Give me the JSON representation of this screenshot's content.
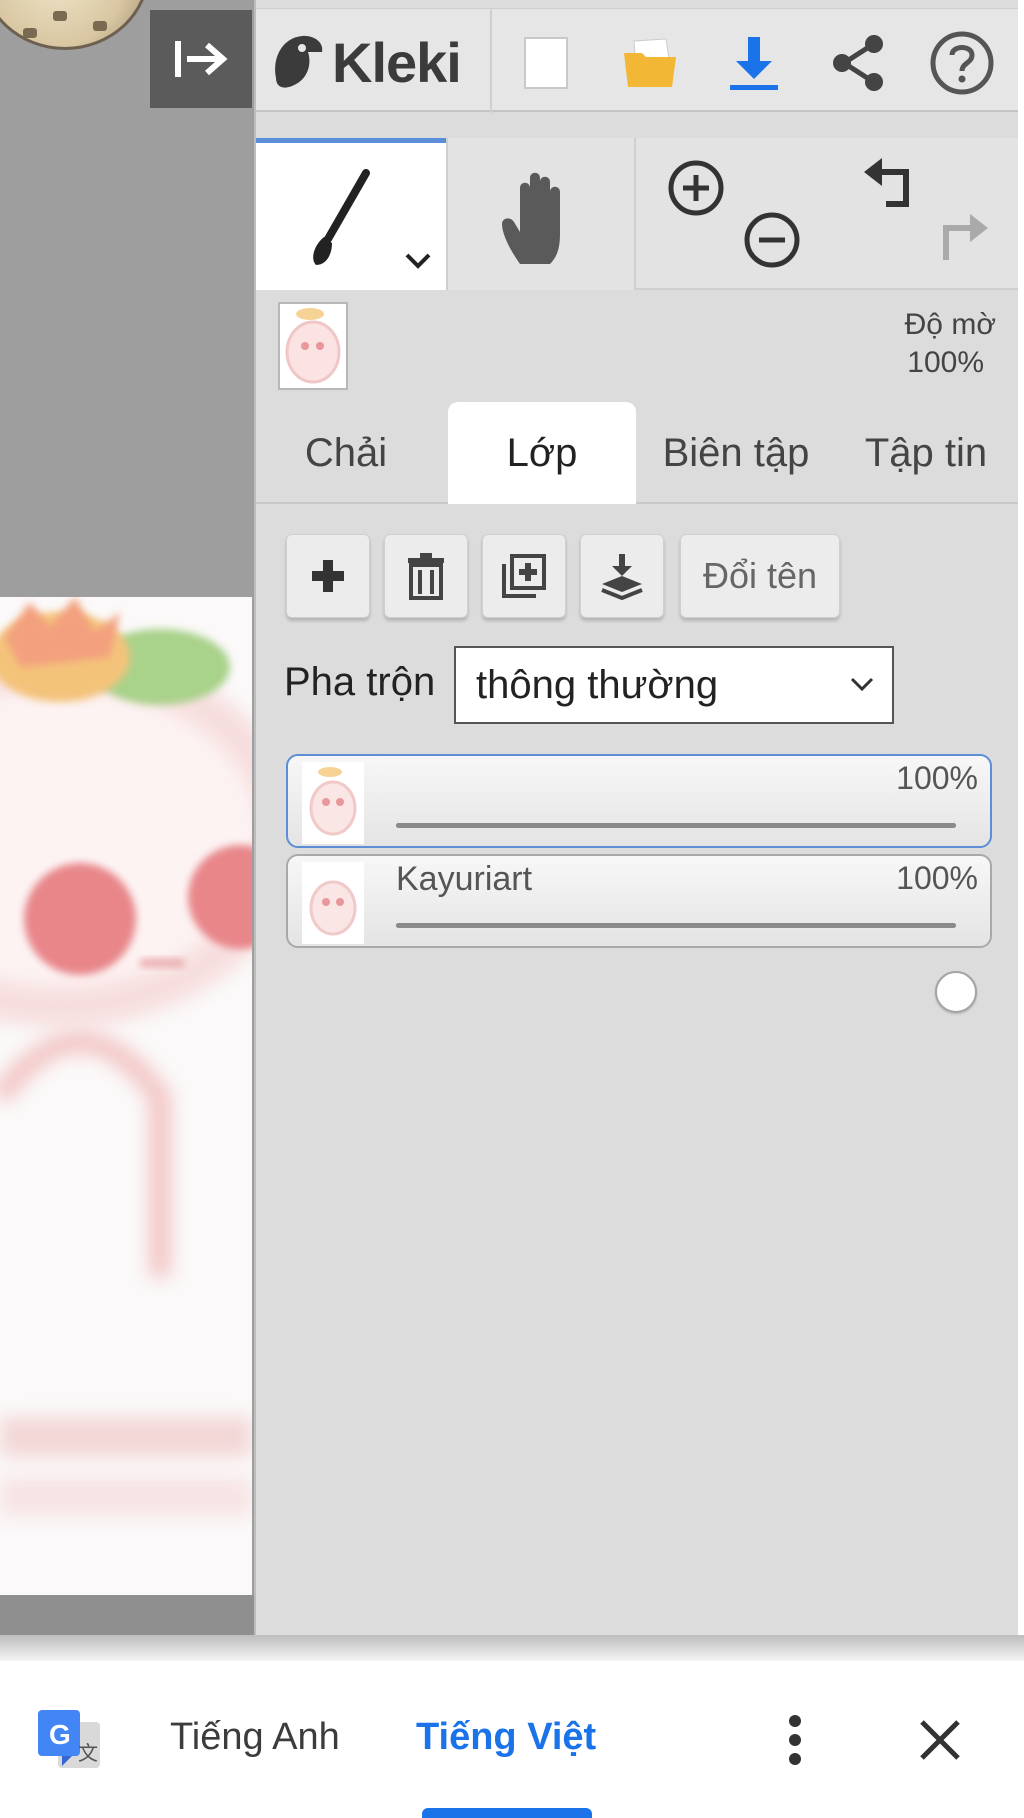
{
  "app": {
    "logo_text": "Kleki"
  },
  "top_toolbar": {
    "icons": [
      "collapse-panel-icon",
      "new-page-icon",
      "open-folder-icon",
      "download-icon",
      "share-icon",
      "help-icon"
    ],
    "accent": "#1a73e8",
    "folder_color": "#f2b735"
  },
  "tool_row": {
    "tools": [
      "brush-icon",
      "hand-icon",
      "zoom-in-icon",
      "zoom-out-icon",
      "undo-icon",
      "redo-icon"
    ],
    "active_tool": "brush",
    "active_indicator_color": "#5b8ed6"
  },
  "layer_preview": {
    "opacity_label": "Độ mờ",
    "opacity_value": "100%"
  },
  "tabs": [
    {
      "label": "Chải"
    },
    {
      "label": "Lớp",
      "active": true
    },
    {
      "label": "Biên tập"
    },
    {
      "label": "Tập tin"
    }
  ],
  "layer_actions": {
    "icons": [
      "add-layer-icon",
      "delete-layer-icon",
      "duplicate-layer-icon",
      "merge-down-icon"
    ],
    "rename_label": "Đổi tên"
  },
  "blend": {
    "label": "Pha trộn",
    "value": "thông thường"
  },
  "layers": [
    {
      "name": "",
      "opacity_text": "100%",
      "opacity": 1.0,
      "selected": true
    },
    {
      "name": "Kayuriart",
      "opacity_text": "100%",
      "opacity": 1.0,
      "selected": false
    }
  ],
  "translate_bar": {
    "source_lang": "Tiếng Anh",
    "target_lang": "Tiếng Việt",
    "active_color": "#1a73e8",
    "icons": [
      "google-translate-icon",
      "more-options-icon",
      "close-icon"
    ]
  }
}
